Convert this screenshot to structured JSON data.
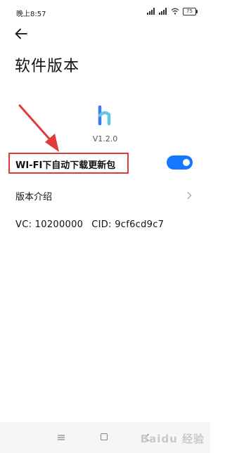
{
  "status_bar": {
    "time": "晚上8:57",
    "battery": "75"
  },
  "header": {
    "title": "软件版本"
  },
  "app": {
    "version": "V1.2.0"
  },
  "settings": {
    "wifi_auto_update_label": "WI-FI下自动下载更新包",
    "wifi_auto_update_on": true,
    "version_intro_label": "版本介绍"
  },
  "ids": {
    "vc": "VC: 10200000",
    "cid": "CID: 9cf6cd9c7"
  },
  "watermark": "Baidu 经验",
  "colors": {
    "accent": "#1677ff",
    "annotation": "#e23b3b"
  }
}
